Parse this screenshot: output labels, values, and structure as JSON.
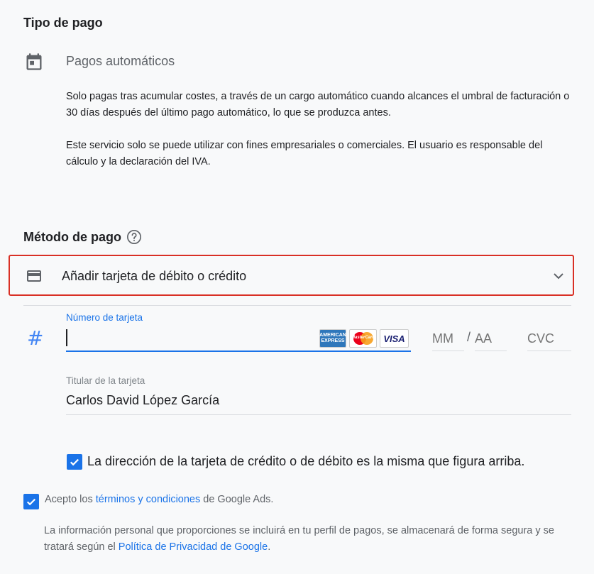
{
  "payment_type": {
    "heading": "Tipo de pago",
    "option": "Pagos automáticos",
    "description": "Solo pagas tras acumular costes, a través de un cargo automático cuando alcances el umbral de facturación o 30 días después del último pago automático, lo que se produzca antes.",
    "notice": "Este servicio solo se puede utilizar con fines empresariales o comerciales. El usuario es responsable del cálculo y la declaración del IVA."
  },
  "payment_method": {
    "heading": "Método de pago",
    "selector_label": "Añadir tarjeta de débito o crédito",
    "card_number_label": "Número de tarjeta",
    "card_number_value": "",
    "brands": {
      "amex": "AMERICAN EXPRESS",
      "mastercard": "MasterCard",
      "visa": "VISA"
    },
    "month_placeholder": "MM",
    "separator": "/",
    "year_placeholder": "AA",
    "cvc_placeholder": "CVC",
    "holder_label": "Titular de la tarjeta",
    "holder_value": "Carlos David López García",
    "same_address_label": "La dirección de la tarjeta de crédito o de débito es la misma que figura arriba."
  },
  "terms": {
    "prefix": "Acepto los ",
    "link": "términos y condiciones",
    "suffix": " de Google Ads."
  },
  "privacy": {
    "text": "La información personal que proporciones se incluirá en tu perfil de pagos, se almacenará de forma segura y se tratará según el ",
    "link": "Política de Privacidad de Google",
    "suffix": "."
  },
  "colors": {
    "accent": "#1a73e8",
    "highlight_border": "#d93025"
  }
}
